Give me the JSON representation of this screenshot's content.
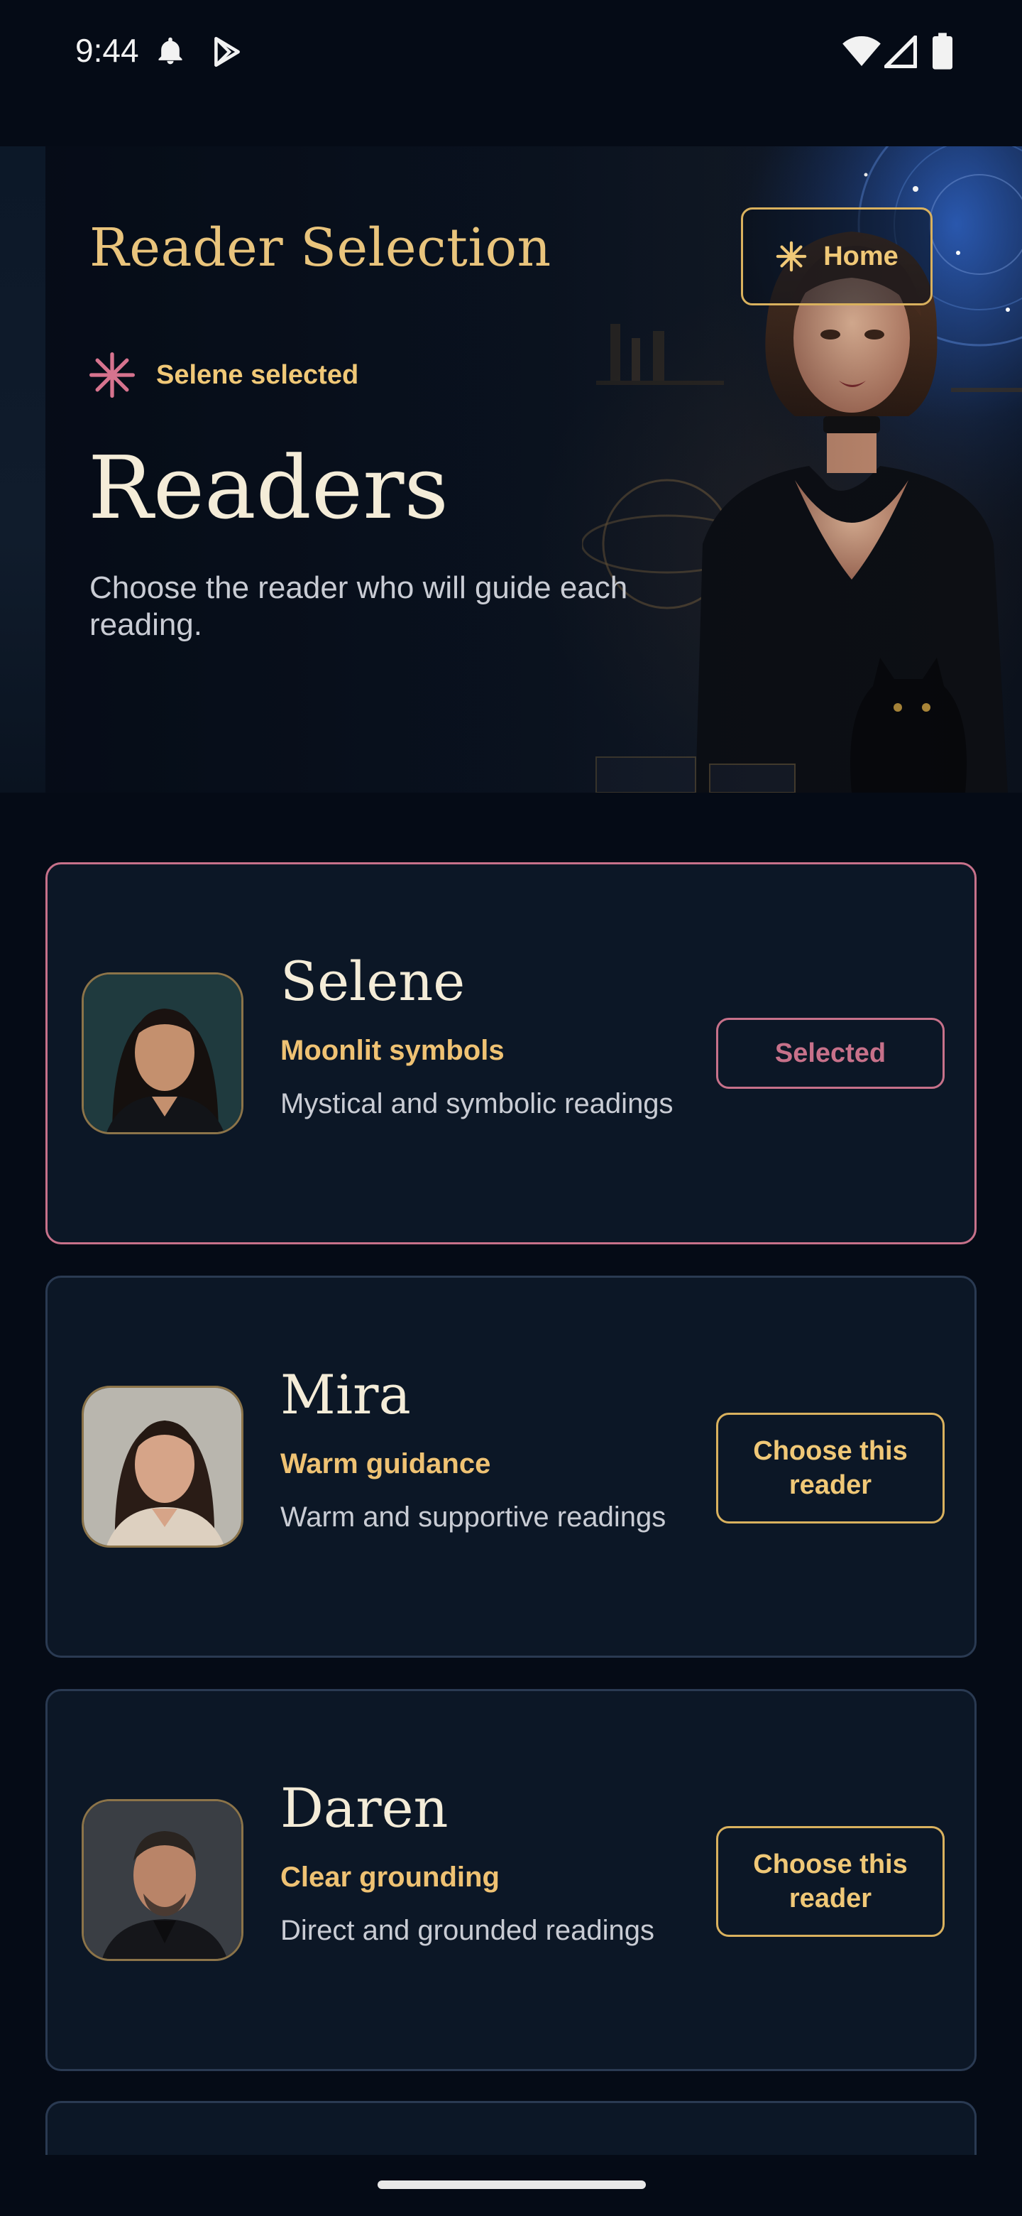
{
  "status_bar": {
    "time": "9:44",
    "icons": [
      "bell-icon",
      "play-store-icon",
      "wifi-icon",
      "cell-signal-icon",
      "battery-icon"
    ]
  },
  "hero": {
    "section_title": "Reader Selection",
    "home_button": {
      "label": "Home",
      "icon": "sparkle-icon"
    },
    "selected_indicator": {
      "label": "Selene selected",
      "icon": "asterisk-icon"
    },
    "heading": "Readers",
    "subtitle": "Choose the reader who will guide each reading."
  },
  "readers": [
    {
      "name": "Selene",
      "tagline": "Moonlit symbols",
      "description": "Mystical and symbolic readings",
      "button_label": "Selected",
      "selected": true
    },
    {
      "name": "Mira",
      "tagline": "Warm guidance",
      "description": "Warm and supportive readings",
      "button_label": "Choose this reader",
      "selected": false
    },
    {
      "name": "Daren",
      "tagline": "Clear grounding",
      "description": "Direct and grounded readings",
      "button_label": "Choose this reader",
      "selected": false
    }
  ],
  "colors": {
    "background": "#050b16",
    "card": "#0c1726",
    "gold_accent": "#f0c877",
    "selected_rose": "#c7718a",
    "heading_cream": "#f4ecd8"
  }
}
